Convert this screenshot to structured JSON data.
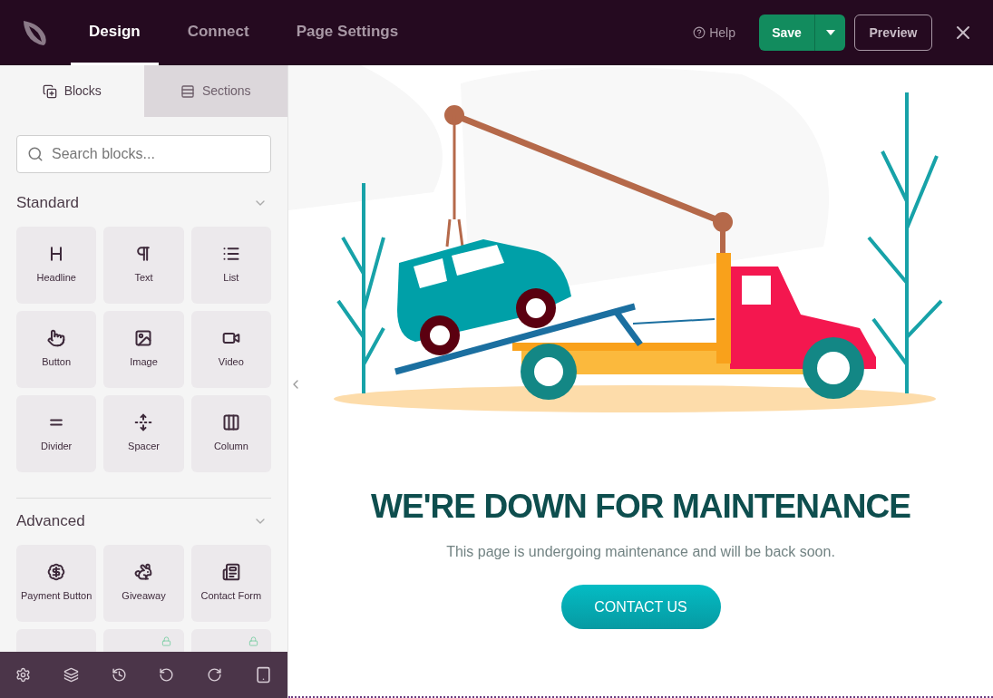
{
  "top_bar": {
    "tabs": [
      {
        "label": "Design",
        "selected": true
      },
      {
        "label": "Connect",
        "selected": false
      },
      {
        "label": "Page Settings",
        "selected": false
      }
    ],
    "help": "Help",
    "save": "Save",
    "preview": "Preview"
  },
  "sidebar": {
    "tabs": [
      {
        "label": "Blocks",
        "selected": true,
        "kind": "blocks"
      },
      {
        "label": "Sections",
        "selected": false,
        "kind": "sections"
      }
    ],
    "search": {
      "placeholder": "Search blocks..."
    },
    "groups": [
      {
        "title": "Standard",
        "expanded": true,
        "blocks": [
          {
            "label": "Headline",
            "kind": "headline",
            "locked": false
          },
          {
            "label": "Text",
            "kind": "text",
            "locked": false
          },
          {
            "label": "List",
            "kind": "list",
            "locked": false
          },
          {
            "label": "Button",
            "kind": "button",
            "locked": false
          },
          {
            "label": "Image",
            "kind": "image",
            "locked": false
          },
          {
            "label": "Video",
            "kind": "video",
            "locked": false
          },
          {
            "label": "Divider",
            "kind": "divider",
            "locked": false
          },
          {
            "label": "Spacer",
            "kind": "spacer",
            "locked": false
          },
          {
            "label": "Column",
            "kind": "column",
            "locked": false
          }
        ]
      },
      {
        "title": "Advanced",
        "expanded": true,
        "blocks": [
          {
            "label": "Payment Button",
            "kind": "payment",
            "locked": false
          },
          {
            "label": "Giveaway",
            "kind": "giveaway",
            "locked": false
          },
          {
            "label": "Contact Form",
            "kind": "form",
            "locked": false
          },
          {
            "kind": "blank",
            "locked": false
          },
          {
            "kind": "blank",
            "locked": true
          },
          {
            "kind": "blank",
            "locked": true
          }
        ]
      }
    ]
  },
  "page": {
    "headline": "WE'RE DOWN FOR MAINTENANCE",
    "text": "This page is undergoing maintenance and will be back soon.",
    "button": "CONTACT US"
  }
}
